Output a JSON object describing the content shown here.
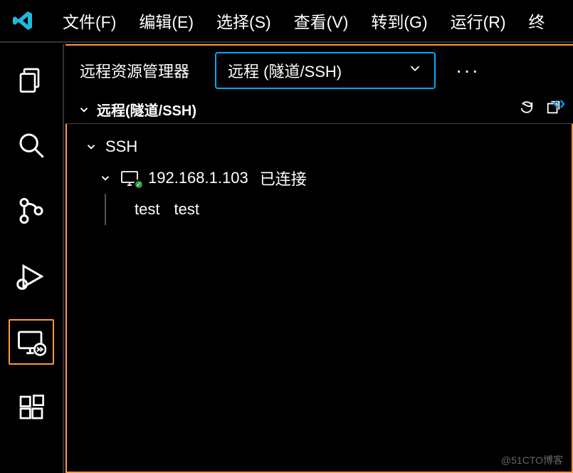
{
  "menubar": {
    "items": [
      "文件(F)",
      "编辑(E)",
      "选择(S)",
      "查看(V)",
      "转到(G)",
      "运行(R)",
      "终"
    ]
  },
  "explorer": {
    "title": "远程资源管理器",
    "dropdown_label": "远程 (隧道/SSH)",
    "section_title": "远程(隧道/SSH)"
  },
  "tree": {
    "group": "SSH",
    "host_ip": "192.168.1.103",
    "host_status": "已连接",
    "folder_name": "test",
    "folder_label": "test"
  },
  "icons": {
    "chevron_down": "⌄",
    "more": "···"
  },
  "watermark": "@51CTO博客"
}
